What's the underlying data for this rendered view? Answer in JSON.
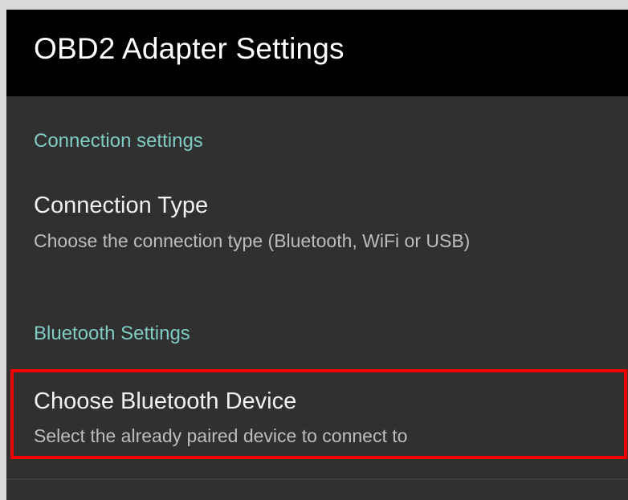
{
  "appbar": {
    "title": "OBD2 Adapter Settings"
  },
  "categories": {
    "connection": "Connection settings",
    "bluetooth": "Bluetooth Settings"
  },
  "preferences": {
    "connection_type": {
      "title": "Connection Type",
      "summary": "Choose the connection type (Bluetooth, WiFi or USB)"
    },
    "bluetooth_device": {
      "title": "Choose Bluetooth Device",
      "summary": "Select the already paired device to connect to",
      "highlighted": true
    }
  },
  "colors": {
    "accent": "#80cbc4",
    "background": "#303030",
    "appbar": "#000000",
    "highlight_border": "#ee0000"
  }
}
